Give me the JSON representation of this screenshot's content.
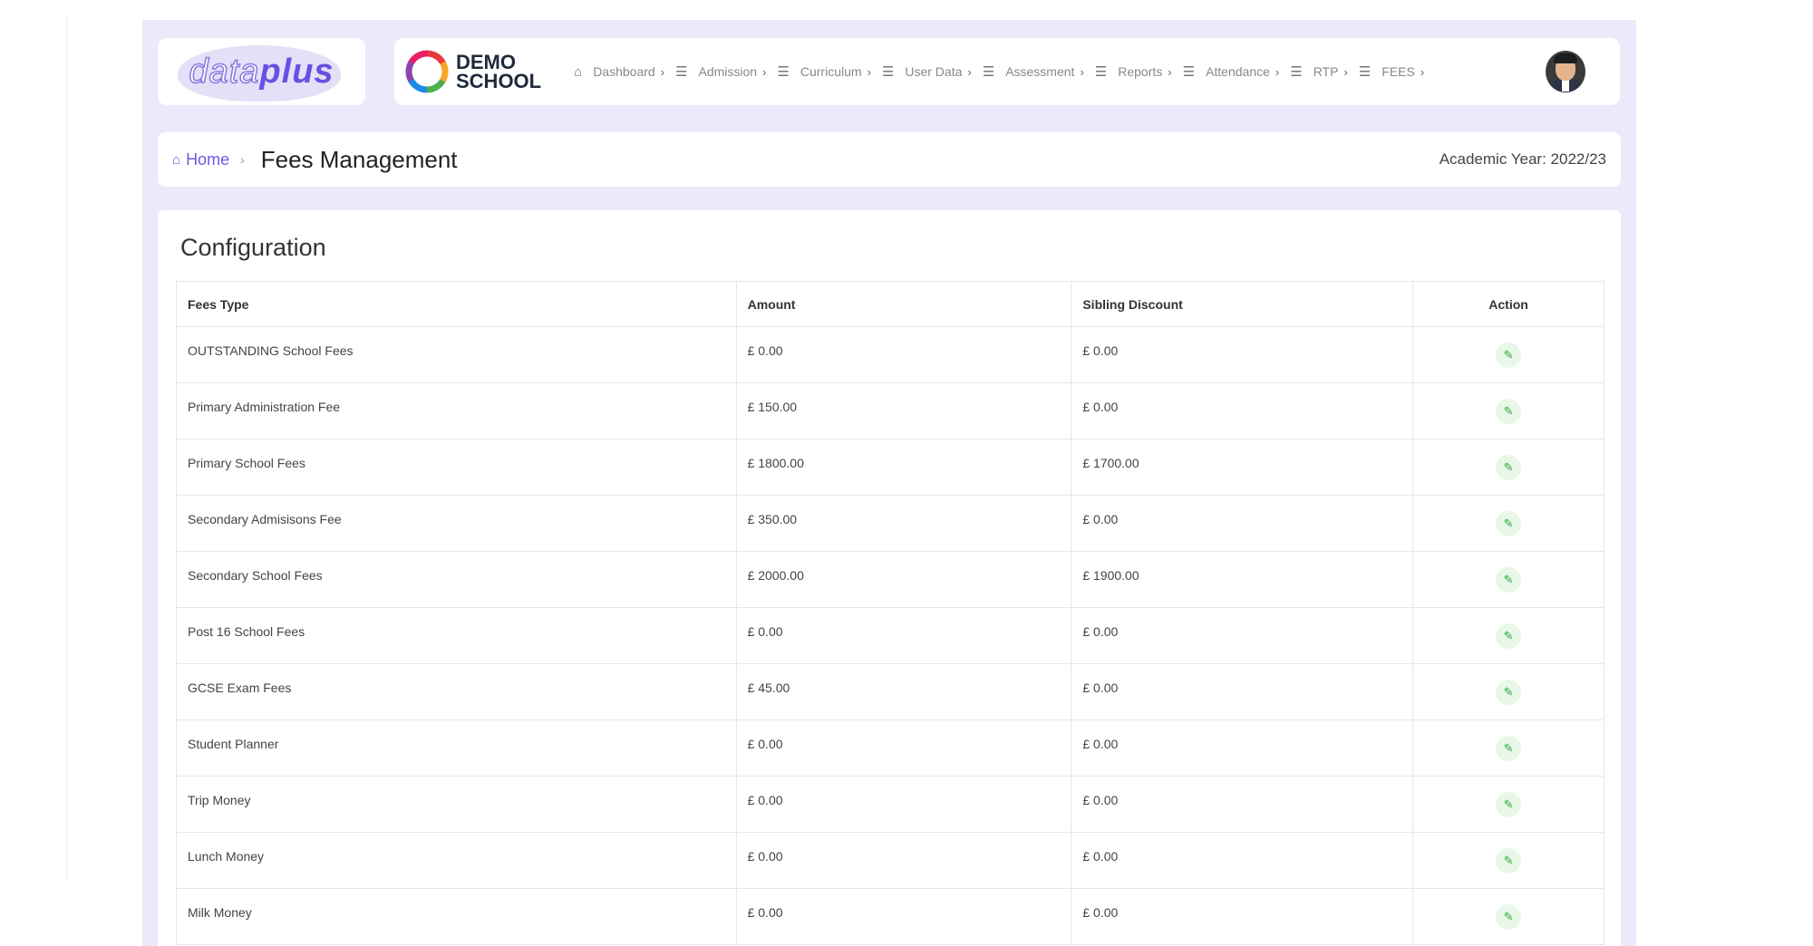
{
  "brand": {
    "logo_light": "data",
    "logo_bold": "plus"
  },
  "school": {
    "line1": "DEMO",
    "line2": "SCHOOL"
  },
  "nav": [
    {
      "label": "Dashboard",
      "icon": "home-icon"
    },
    {
      "label": "Admission",
      "icon": "menu-icon"
    },
    {
      "label": "Curriculum",
      "icon": "menu-icon"
    },
    {
      "label": "User Data",
      "icon": "menu-icon"
    },
    {
      "label": "Assessment",
      "icon": "menu-icon"
    },
    {
      "label": "Reports",
      "icon": "menu-icon"
    },
    {
      "label": "Attendance",
      "icon": "menu-icon"
    },
    {
      "label": "RTP",
      "icon": "menu-icon"
    },
    {
      "label": "FEES",
      "icon": "menu-icon"
    }
  ],
  "breadcrumb": {
    "home": "Home",
    "title": "Fees Management",
    "academic_year": "Academic Year: 2022/23"
  },
  "config": {
    "title": "Configuration",
    "columns": [
      "Fees Type",
      "Amount",
      "Sibling Discount",
      "Action"
    ],
    "rows": [
      {
        "type": "OUTSTANDING School Fees",
        "amount": "£ 0.00",
        "discount": "£ 0.00"
      },
      {
        "type": "Primary Administration Fee",
        "amount": "£ 150.00",
        "discount": "£ 0.00"
      },
      {
        "type": "Primary School Fees",
        "amount": "£ 1800.00",
        "discount": "£ 1700.00"
      },
      {
        "type": "Secondary Admisisons Fee",
        "amount": "£ 350.00",
        "discount": "£ 0.00"
      },
      {
        "type": "Secondary School Fees",
        "amount": "£ 2000.00",
        "discount": "£ 1900.00"
      },
      {
        "type": "Post 16 School Fees",
        "amount": "£ 0.00",
        "discount": "£ 0.00"
      },
      {
        "type": "GCSE Exam Fees",
        "amount": "£ 45.00",
        "discount": "£ 0.00"
      },
      {
        "type": "Student Planner",
        "amount": "£ 0.00",
        "discount": "£ 0.00"
      },
      {
        "type": "Trip Money",
        "amount": "£ 0.00",
        "discount": "£ 0.00"
      },
      {
        "type": "Lunch Money",
        "amount": "£ 0.00",
        "discount": "£ 0.00"
      },
      {
        "type": "Milk Money",
        "amount": "£ 0.00",
        "discount": "£ 0.00"
      }
    ]
  },
  "colors": {
    "accent": "#6a5be0",
    "page_bg": "#ece9fb",
    "edit_green": "#2faa3a"
  }
}
